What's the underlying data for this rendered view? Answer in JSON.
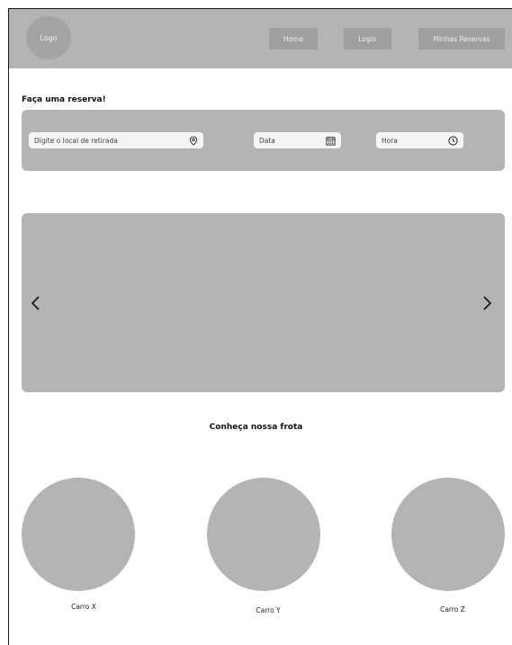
{
  "header": {
    "logo_label": "Logo",
    "nav": {
      "home": "Home",
      "login": "Login",
      "reservas": "Minhas Reservas"
    }
  },
  "booking": {
    "title": "Faça uma reserva!",
    "fields": {
      "local": {
        "placeholder": "Digite o local de retirada",
        "icon": "location-pin-icon"
      },
      "data": {
        "placeholder": "Data",
        "icon": "calendar-icon"
      },
      "hora": {
        "placeholder": "Hora",
        "icon": "clock-icon"
      }
    }
  },
  "carousel": {
    "prev_icon": "chevron-left-icon",
    "next_icon": "chevron-right-icon"
  },
  "fleet": {
    "title": "Conheça nossa frota",
    "cars": [
      {
        "label": "Carro X"
      },
      {
        "label": "Carro Y"
      },
      {
        "label": "Carro Z"
      }
    ]
  },
  "colors": {
    "panel_gray": "#b4b4b4",
    "button_gray": "#9f9f9f",
    "field_bg": "#f5f5f5"
  }
}
